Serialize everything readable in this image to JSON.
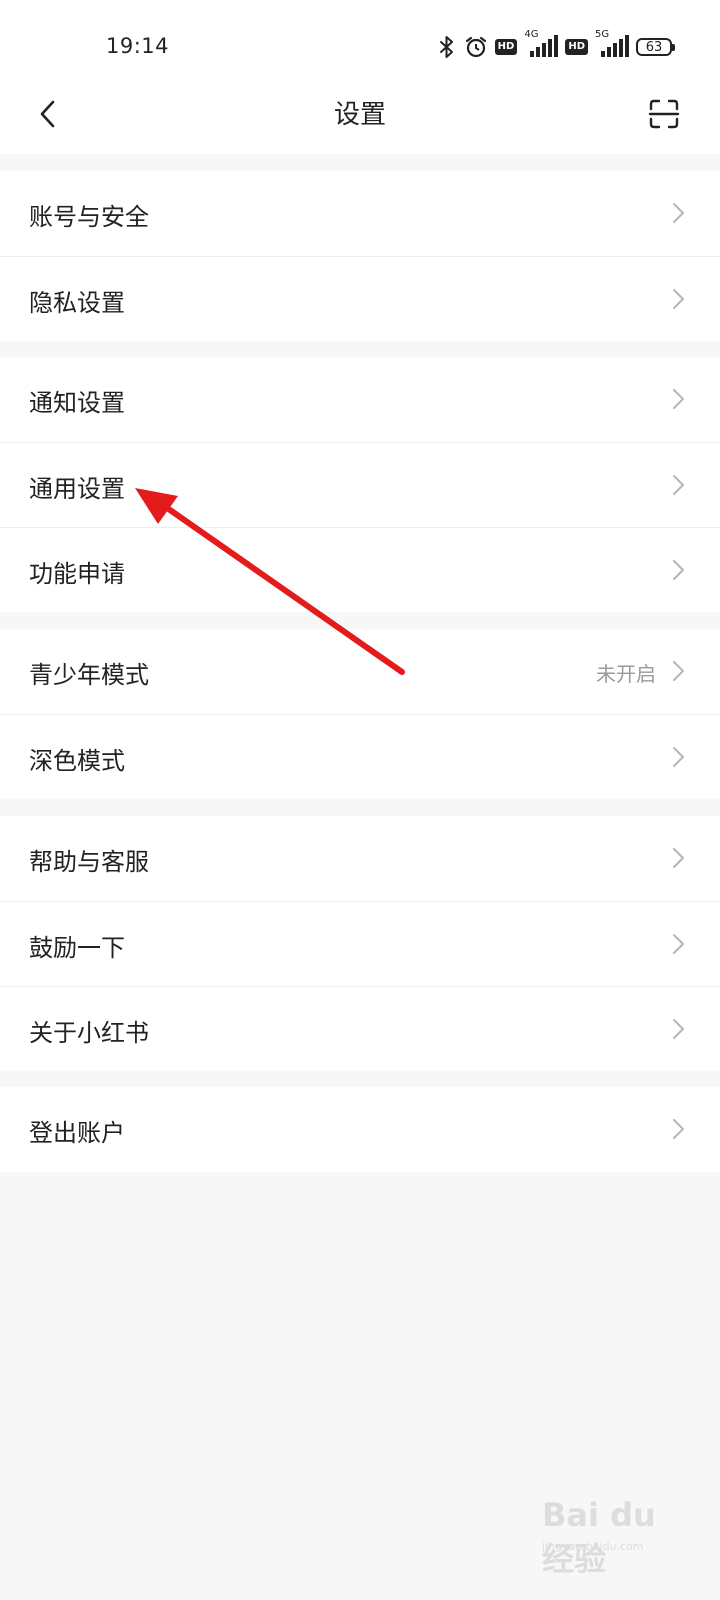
{
  "status_bar": {
    "time": "19:14",
    "net1": "4G",
    "net2": "5G",
    "hd1": "HD",
    "hd2": "HD",
    "battery": "63",
    "icons": [
      "bluetooth-icon",
      "alarm-icon",
      "hd-badge",
      "signal-4g-icon",
      "hd-badge",
      "signal-5g-icon",
      "battery-icon"
    ]
  },
  "header": {
    "title": "设置",
    "back_icon": "chevron-left-icon",
    "scan_icon": "scan-icon"
  },
  "groups": [
    {
      "items": [
        {
          "label": "账号与安全"
        },
        {
          "label": "隐私设置"
        }
      ]
    },
    {
      "items": [
        {
          "label": "通知设置"
        },
        {
          "label": "通用设置"
        },
        {
          "label": "功能申请"
        }
      ]
    },
    {
      "items": [
        {
          "label": "青少年模式",
          "value": "未开启"
        },
        {
          "label": "深色模式"
        }
      ]
    },
    {
      "items": [
        {
          "label": "帮助与客服"
        },
        {
          "label": "鼓励一下"
        },
        {
          "label": "关于小红书"
        }
      ]
    },
    {
      "items": [
        {
          "label": "登出账户"
        }
      ]
    }
  ],
  "annotation": {
    "type": "arrow",
    "color": "#e31b1b",
    "points_to": "通用设置"
  },
  "watermark": {
    "text": "Bai du 经验",
    "sub": "jingyan.baidu.com"
  },
  "colors": {
    "background": "#f7f7f7",
    "surface": "#ffffff",
    "text": "#222222",
    "secondary_text": "#9a9a9a",
    "chevron": "#b5b5b5",
    "annotation": "#e31b1b"
  }
}
